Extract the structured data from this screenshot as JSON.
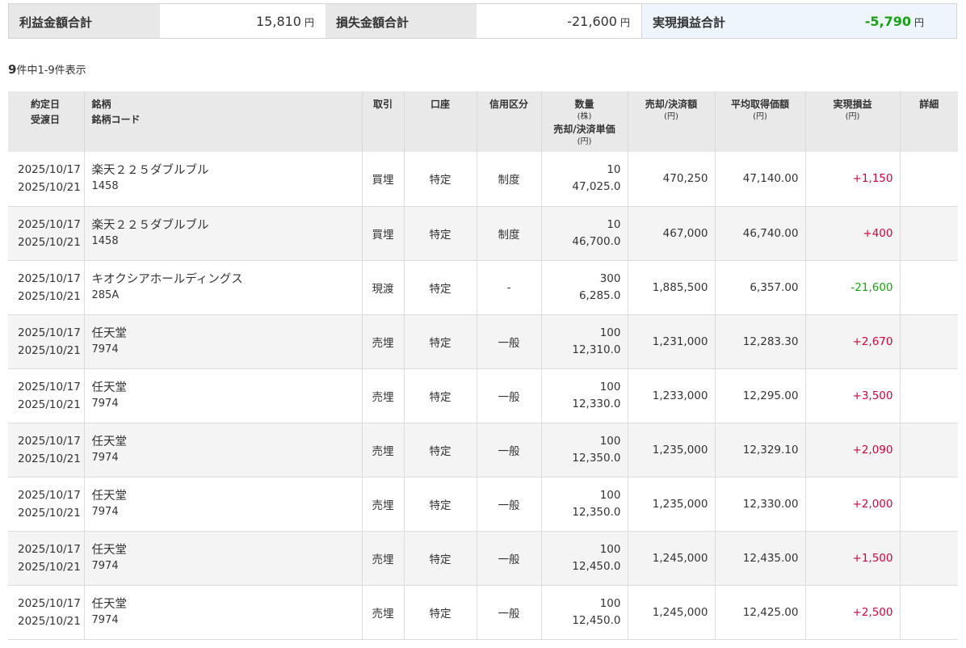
{
  "summary": {
    "profit_label": "利益金額合計",
    "profit_value": "15,810",
    "loss_label": "損失金額合計",
    "loss_value": "-21,600",
    "net_label": "実現損益合計",
    "net_value": "-5,790",
    "yen": "円"
  },
  "count": {
    "total": "9",
    "text": "件中1-9件表示"
  },
  "table": {
    "headers": {
      "date1": "約定日",
      "date2": "受渡日",
      "name1": "銘柄",
      "name2": "銘柄コード",
      "trade": "取引",
      "account": "口座",
      "credit": "信用区分",
      "qty": "数量",
      "qty_unit": "(株)",
      "price": "売却/決済単価",
      "price_unit": "(円)",
      "amount": "売却/決済額",
      "amount_unit": "(円)",
      "avg": "平均取得価額",
      "avg_unit": "(円)",
      "pl": "実現損益",
      "pl_unit": "(円)",
      "detail": "詳細"
    },
    "rows": [
      {
        "trade_date": "2025/10/17",
        "settle_date": "2025/10/21",
        "name": "楽天２２５ダブルブル",
        "code": "1458",
        "trade": "買埋",
        "account": "特定",
        "credit": "制度",
        "qty": "10",
        "price": "47,025.0",
        "amount": "470,250",
        "avg": "47,140.00",
        "pl": "+1,150",
        "sign": "plus"
      },
      {
        "trade_date": "2025/10/17",
        "settle_date": "2025/10/21",
        "name": "楽天２２５ダブルブル",
        "code": "1458",
        "trade": "買埋",
        "account": "特定",
        "credit": "制度",
        "qty": "10",
        "price": "46,700.0",
        "amount": "467,000",
        "avg": "46,740.00",
        "pl": "+400",
        "sign": "plus"
      },
      {
        "trade_date": "2025/10/17",
        "settle_date": "2025/10/21",
        "name": "キオクシアホールディングス",
        "code": "285A",
        "trade": "現渡",
        "account": "特定",
        "credit": "-",
        "qty": "300",
        "price": "6,285.0",
        "amount": "1,885,500",
        "avg": "6,357.00",
        "pl": "-21,600",
        "sign": "minus"
      },
      {
        "trade_date": "2025/10/17",
        "settle_date": "2025/10/21",
        "name": "任天堂",
        "code": "7974",
        "trade": "売埋",
        "account": "特定",
        "credit": "一般",
        "qty": "100",
        "price": "12,310.0",
        "amount": "1,231,000",
        "avg": "12,283.30",
        "pl": "+2,670",
        "sign": "plus"
      },
      {
        "trade_date": "2025/10/17",
        "settle_date": "2025/10/21",
        "name": "任天堂",
        "code": "7974",
        "trade": "売埋",
        "account": "特定",
        "credit": "一般",
        "qty": "100",
        "price": "12,330.0",
        "amount": "1,233,000",
        "avg": "12,295.00",
        "pl": "+3,500",
        "sign": "plus"
      },
      {
        "trade_date": "2025/10/17",
        "settle_date": "2025/10/21",
        "name": "任天堂",
        "code": "7974",
        "trade": "売埋",
        "account": "特定",
        "credit": "一般",
        "qty": "100",
        "price": "12,350.0",
        "amount": "1,235,000",
        "avg": "12,329.10",
        "pl": "+2,090",
        "sign": "plus"
      },
      {
        "trade_date": "2025/10/17",
        "settle_date": "2025/10/21",
        "name": "任天堂",
        "code": "7974",
        "trade": "売埋",
        "account": "特定",
        "credit": "一般",
        "qty": "100",
        "price": "12,350.0",
        "amount": "1,235,000",
        "avg": "12,330.00",
        "pl": "+2,000",
        "sign": "plus"
      },
      {
        "trade_date": "2025/10/17",
        "settle_date": "2025/10/21",
        "name": "任天堂",
        "code": "7974",
        "trade": "売埋",
        "account": "特定",
        "credit": "一般",
        "qty": "100",
        "price": "12,450.0",
        "amount": "1,245,000",
        "avg": "12,435.00",
        "pl": "+1,500",
        "sign": "plus"
      },
      {
        "trade_date": "2025/10/17",
        "settle_date": "2025/10/21",
        "name": "任天堂",
        "code": "7974",
        "trade": "売埋",
        "account": "特定",
        "credit": "一般",
        "qty": "100",
        "price": "12,450.0",
        "amount": "1,245,000",
        "avg": "12,425.00",
        "pl": "+2,500",
        "sign": "plus"
      }
    ]
  }
}
